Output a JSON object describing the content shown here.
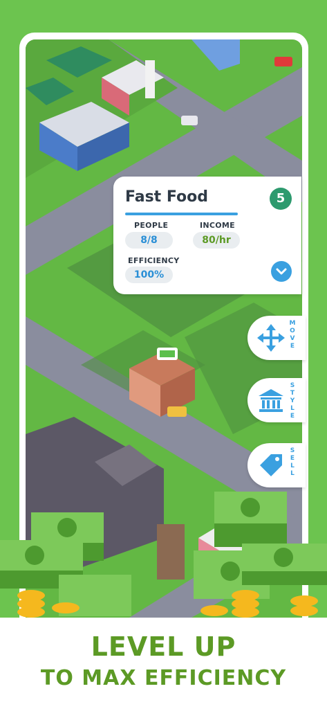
{
  "card": {
    "title": "Fast Food",
    "level": "5",
    "people_label": "PEOPLE",
    "people_value": "8/8",
    "income_label": "INCOME",
    "income_value": "80/hr",
    "efficiency_label": "EFFICIENCY",
    "efficiency_value": "100%"
  },
  "actions": {
    "move": "MOVE",
    "style": "STYLE",
    "sell": "SELL"
  },
  "promo": {
    "line1": "LEVEL UP",
    "line2": "TO MAX EFFICIENCY"
  },
  "colors": {
    "background": "#6cc44f",
    "accent_blue": "#3aa0e0",
    "level_badge": "#2d9a6e",
    "headline": "#5c9a25"
  }
}
